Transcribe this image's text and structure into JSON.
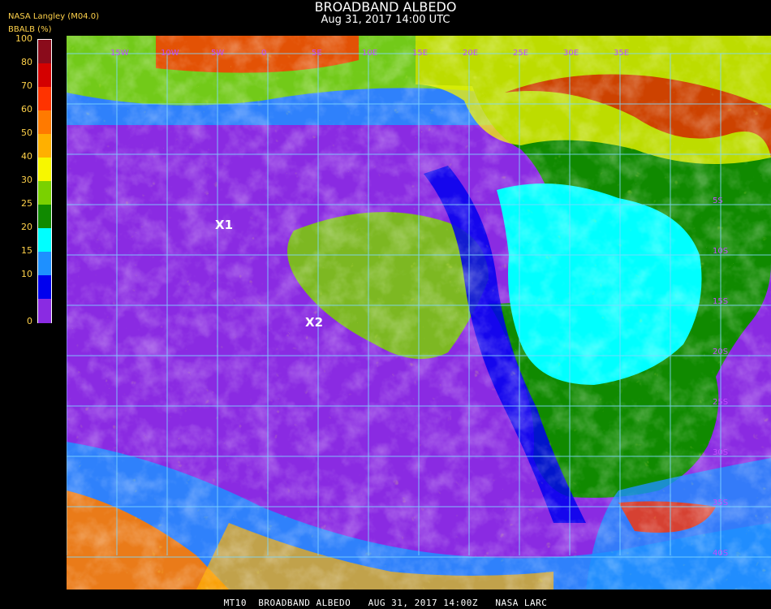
{
  "header": {
    "title": "BROADBAND ALBEDO",
    "subtitle": "Aug 31, 2017 14:00 UTC",
    "source": "NASA Langley (M04.0)",
    "units": "BBALB (%)"
  },
  "colorbar": {
    "ticks": [
      "100",
      "80",
      "70",
      "60",
      "50",
      "40",
      "30",
      "25",
      "20",
      "15",
      "10",
      "0"
    ],
    "colors": [
      "#8a0b1b",
      "#d40000",
      "#ff3300",
      "#ff7a00",
      "#ffb000",
      "#f7f700",
      "#7ad100",
      "#108a00",
      "#00ffff",
      "#1e90ff",
      "#0000ee",
      "#8a2be2"
    ]
  },
  "map": {
    "lon_labels": [
      "15W",
      "10W",
      "5W",
      "0",
      "5E",
      "10E",
      "15E",
      "20E",
      "25E",
      "30E",
      "35E"
    ],
    "lat_labels": [
      "5S",
      "10S",
      "15S",
      "20S",
      "25S",
      "30S",
      "35S",
      "40S"
    ],
    "markers": [
      "X1",
      "X2"
    ]
  },
  "footer": {
    "text": "MT10  BROADBAND ALBEDO   AUG 31, 2017 14:00Z   NASA LARC"
  }
}
